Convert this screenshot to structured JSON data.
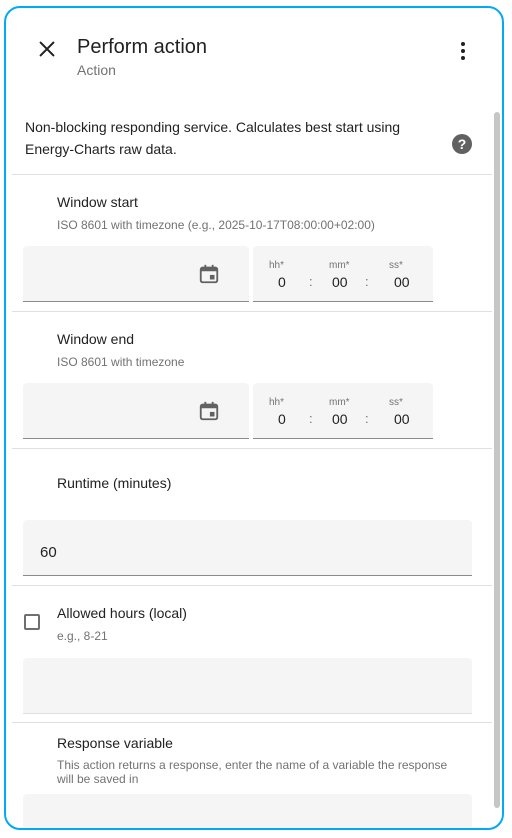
{
  "header": {
    "title": "Perform action",
    "subtitle": "Action",
    "close_icon": "close-icon",
    "more_icon": "more-vertical-icon"
  },
  "description": {
    "text": "Non-blocking responding service. Calculates best start using Energy-Charts raw data.",
    "help_icon": "help-circle-icon"
  },
  "fields": {
    "window_start": {
      "label": "Window start",
      "hint": "ISO 8601 with timezone (e.g., 2025-10-17T08:00:00+02:00)",
      "date_value": "",
      "hh_label": "hh*",
      "mm_label": "mm*",
      "ss_label": "ss*",
      "hh": "0",
      "mm": "00",
      "ss": "00"
    },
    "window_end": {
      "label": "Window end",
      "hint": "ISO 8601 with timezone",
      "date_value": "",
      "hh_label": "hh*",
      "mm_label": "mm*",
      "ss_label": "ss*",
      "hh": "0",
      "mm": "00",
      "ss": "00"
    },
    "runtime": {
      "label": "Runtime (minutes)",
      "value": "60"
    },
    "allowed_hours": {
      "label": "Allowed hours (local)",
      "hint": "e.g., 8-21",
      "checked": false,
      "value": ""
    },
    "response_variable": {
      "label": "Response variable",
      "hint": "This action returns a response, enter the name of a variable the response will be saved in",
      "value": ""
    }
  },
  "colors": {
    "accent": "#03a9f4",
    "field_bg": "#f5f5f5",
    "secondary_text": "#727272"
  }
}
